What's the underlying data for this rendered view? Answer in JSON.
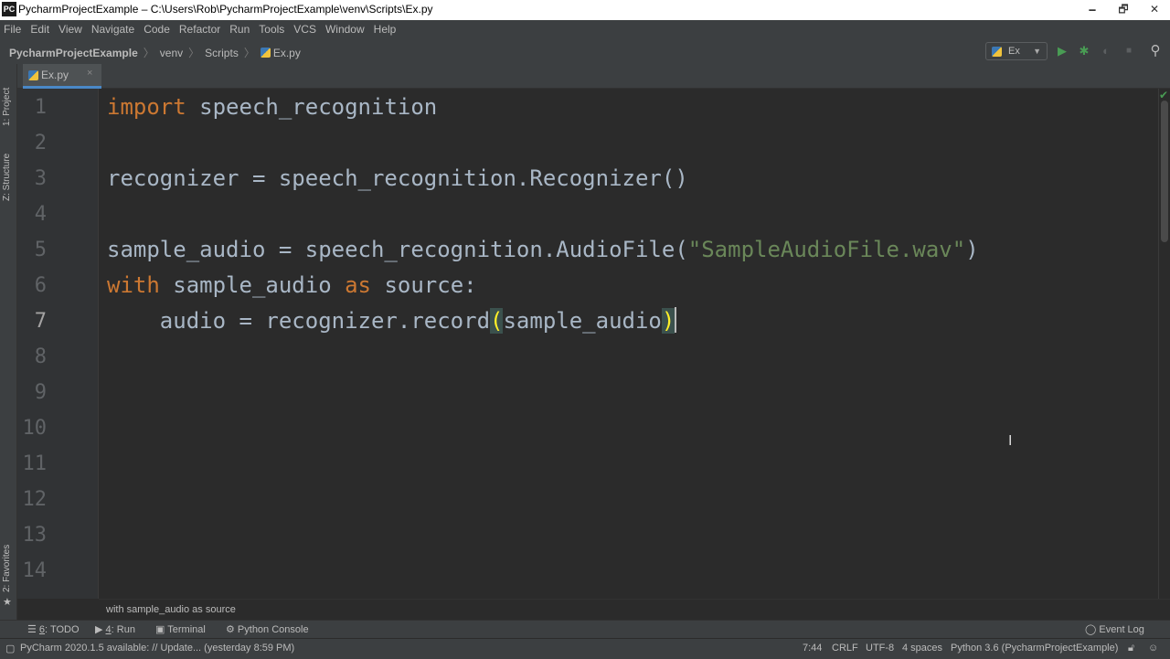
{
  "window": {
    "title": "PycharmProjectExample – C:\\Users\\Rob\\PycharmProjectExample\\venv\\Scripts\\Ex.py",
    "app_icon": "PC",
    "minimize": "🗕",
    "restore": "🗗",
    "close": "✕"
  },
  "menu": [
    "File",
    "Edit",
    "View",
    "Navigate",
    "Code",
    "Refactor",
    "Run",
    "Tools",
    "VCS",
    "Window",
    "Help"
  ],
  "breadcrumb": {
    "project": "PycharmProjectExample",
    "folder1": "venv",
    "folder2": "Scripts",
    "file": "Ex.py",
    "sep": "〉"
  },
  "toolbar": {
    "run_config": "Ex",
    "run_config_chevron": "▼",
    "run_icon": "▶",
    "debug_icon": "✱",
    "coverage_icon": "◐",
    "stop_icon": "■",
    "search_icon": "⚲"
  },
  "side": {
    "project_label": "1: Project",
    "structure_label": "Z: Structure",
    "favorites_label": "2: Favorites",
    "favorites_star": "★"
  },
  "tab": {
    "name": "Ex.py",
    "close": "×"
  },
  "editor": {
    "line_numbers": [
      "1",
      "2",
      "3",
      "4",
      "5",
      "6",
      "7",
      "8",
      "9",
      "10",
      "11",
      "12",
      "13",
      "14"
    ],
    "current_line": "7",
    "lines": {
      "l1_kw": "import",
      "l1_rest": " speech_recognition",
      "l3": "recognizer = speech_recognition.Recognizer()",
      "l5_pre": "sample_audio = speech_recognition.AudioFile(",
      "l5_str": "\"SampleAudioFile.wav\"",
      "l5_post": ")",
      "l6_kw1": "with",
      "l6_mid": " sample_audio ",
      "l6_kw2": "as",
      "l6_post": " source:",
      "l7_pre": "    audio = recognizer.record",
      "l7_open": "(",
      "l7_arg": "sample_audio",
      "l7_close": ")"
    },
    "inspection_ok": "✔",
    "ibeam": "I"
  },
  "hint": "with sample_audio as source",
  "tool_windows": {
    "todo_num": "6",
    "todo": ": TODO",
    "run_num": "4",
    "run": ": Run",
    "terminal": "Terminal",
    "python_console": "Python Console",
    "event_log": "Event Log"
  },
  "status": {
    "message": "PyCharm 2020.1.5 available: // Update... (yesterday 8:59 PM)",
    "position": "7:44",
    "line_sep": "CRLF",
    "encoding": "UTF-8",
    "indent": "4 spaces",
    "interpreter": "Python 3.6 (PycharmProjectExample)"
  }
}
